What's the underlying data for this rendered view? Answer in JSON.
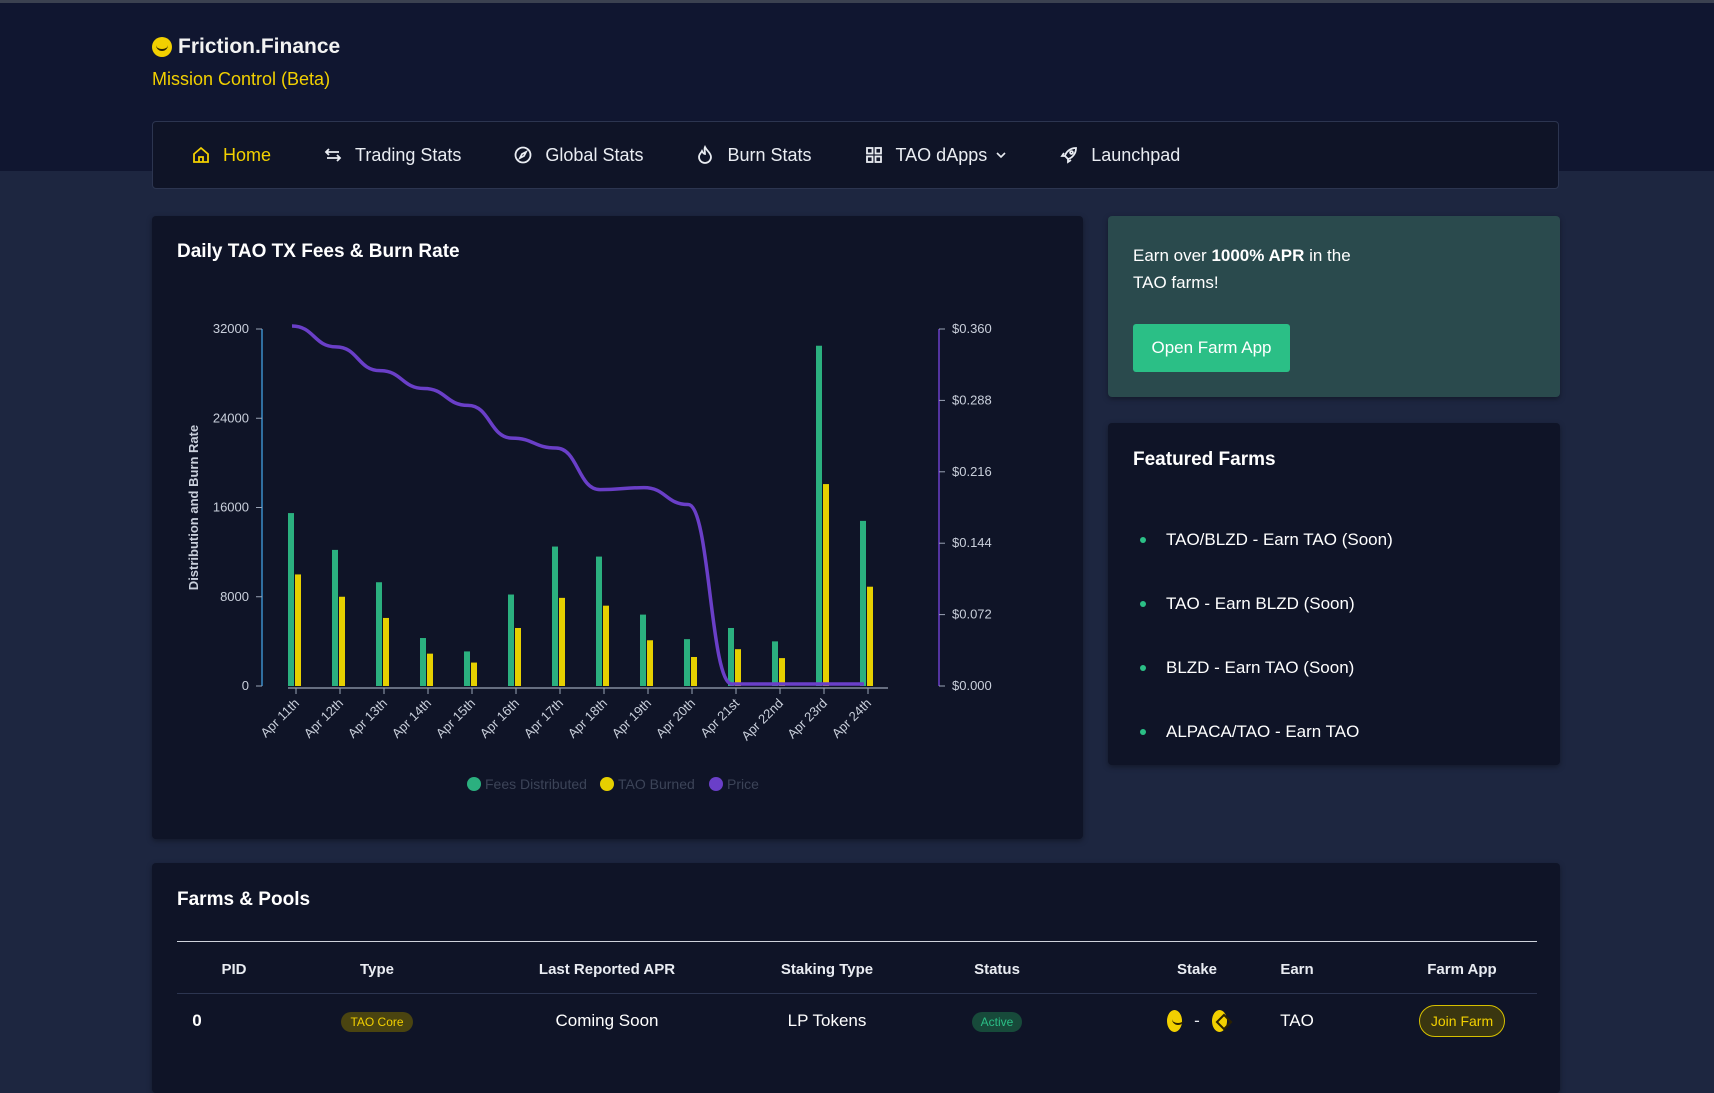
{
  "brand": {
    "name": "Friction.Finance",
    "subtitle": "Mission Control (Beta)"
  },
  "nav": {
    "items": [
      {
        "label": "Home",
        "icon": "home-icon",
        "active": true
      },
      {
        "label": "Trading Stats",
        "icon": "swap-arrows-icon"
      },
      {
        "label": "Global Stats",
        "icon": "compass-icon"
      },
      {
        "label": "Burn Stats",
        "icon": "flame-icon"
      },
      {
        "label": "TAO dApps",
        "icon": "grid-icon",
        "dropdown": true
      },
      {
        "label": "Launchpad",
        "icon": "rocket-icon"
      }
    ]
  },
  "chart_card": {
    "title": "Daily TAO TX Fees & Burn Rate"
  },
  "promo": {
    "text_before": "Earn over ",
    "text_bold": "1000% APR",
    "text_after": " in the TAO farms!",
    "button": "Open Farm App"
  },
  "featured": {
    "title": "Featured Farms",
    "items": [
      "TAO/BLZD - Earn TAO (Soon)",
      "TAO - Earn BLZD (Soon)",
      "BLZD - Earn TAO (Soon)",
      "ALPACA/TAO - Earn TAO"
    ]
  },
  "farms": {
    "title": "Farms & Pools",
    "columns": [
      "PID",
      "Type",
      "Last Reported APR",
      "Staking Type",
      "Status",
      "Stake",
      "Earn",
      "Farm App"
    ],
    "rows": [
      {
        "pid": "0",
        "type": "TAO Core",
        "apr": "Coming Soon",
        "staking_type": "LP Tokens",
        "status": "Active",
        "stake_separator": "-",
        "earn": "TAO",
        "app": "Join Farm"
      }
    ]
  },
  "colors": {
    "fees": "#2bb07f",
    "burned": "#e6d000",
    "price": "#6a3fc8",
    "accent": "#f2d000",
    "button_green": "#2bbf86"
  },
  "chart_data": {
    "type": "bar",
    "title": "",
    "ylabel": "Distribution and Burn Rate",
    "categories": [
      "Apr 11th",
      "Apr 12th",
      "Apr 13th",
      "Apr 14th",
      "Apr 15th",
      "Apr 16th",
      "Apr 17th",
      "Apr 18th",
      "Apr 19th",
      "Apr 20th",
      "Apr 21st",
      "Apr 22nd",
      "Apr 23rd",
      "Apr 24th"
    ],
    "ylim": [
      0,
      32000
    ],
    "y_ticks": [
      "32000",
      "24000",
      "16000",
      "8000",
      "0"
    ],
    "y2lim": [
      0,
      0.36
    ],
    "y2_ticks": [
      "$0.360",
      "$0.288",
      "$0.216",
      "$0.144",
      "$0.072",
      "$0.000"
    ],
    "series": [
      {
        "name": "Fees Distributed",
        "kind": "bar",
        "values": [
          15500,
          12200,
          9300,
          4300,
          3100,
          8200,
          12500,
          11600,
          6400,
          4200,
          5200,
          4000,
          30500,
          14800
        ]
      },
      {
        "name": "TAO Burned",
        "kind": "bar",
        "values": [
          10000,
          8000,
          6100,
          2900,
          2100,
          5200,
          7900,
          7200,
          4100,
          2600,
          3300,
          2500,
          18100,
          8900
        ]
      },
      {
        "name": "Price",
        "kind": "line",
        "axis": "right",
        "values": [
          0.363,
          0.342,
          0.318,
          0.3,
          0.283,
          0.25,
          0.24,
          0.198,
          0.2,
          0.183,
          0.002,
          0.002,
          0.002,
          0.002
        ]
      }
    ],
    "legend_position": "bottom"
  }
}
